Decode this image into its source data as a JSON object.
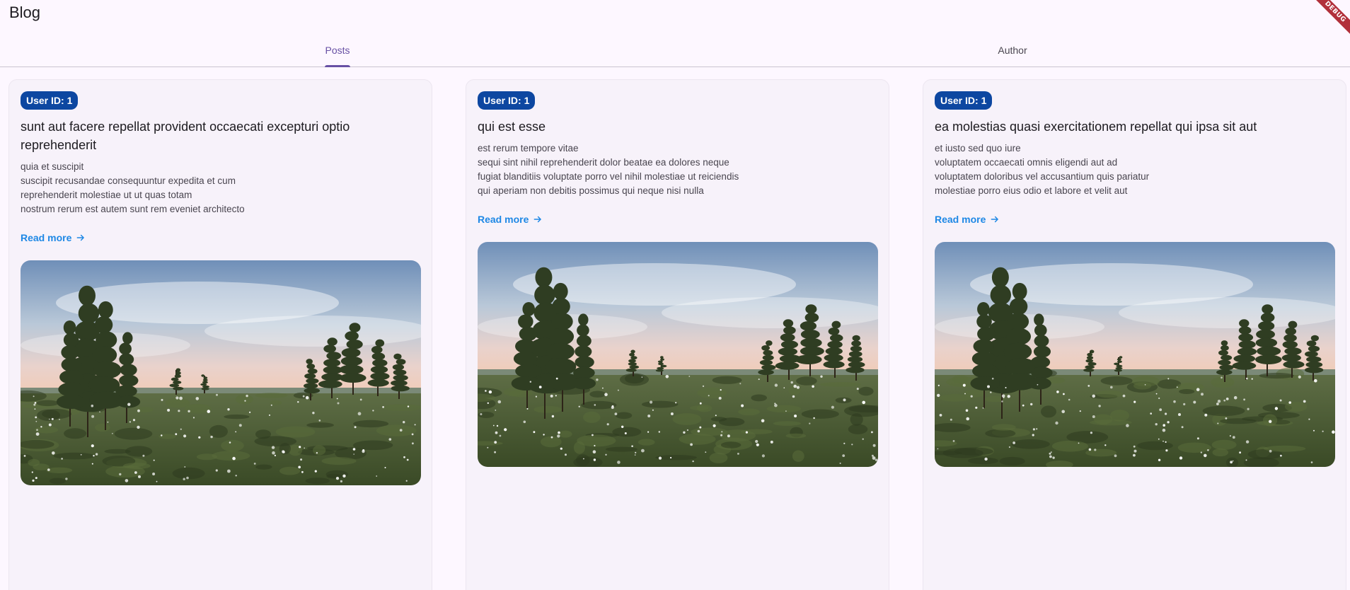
{
  "app": {
    "title": "Blog",
    "debug_banner": "DEBUG"
  },
  "tabs": [
    {
      "label": "Posts",
      "active": true
    },
    {
      "label": "Author",
      "active": false
    }
  ],
  "posts": [
    {
      "badge": "User ID: 1",
      "title": "sunt aut facere repellat provident occaecati excepturi optio reprehenderit",
      "body": "quia et suscipit\nsuscipit recusandae consequuntur expedita et cum\nreprehenderit molestiae ut ut quas totam\nnostrum rerum est autem sunt rem eveniet architecto",
      "read_more": "Read more",
      "image_icon": "landscape-photo"
    },
    {
      "badge": "User ID: 1",
      "title": "qui est esse",
      "body": "est rerum tempore vitae\nsequi sint nihil reprehenderit dolor beatae ea dolores neque\nfugiat blanditiis voluptate porro vel nihil molestiae ut reiciendis\nqui aperiam non debitis possimus qui neque nisi nulla",
      "read_more": "Read more",
      "image_icon": "landscape-photo"
    },
    {
      "badge": "User ID: 1",
      "title": "ea molestias quasi exercitationem repellat qui ipsa sit aut",
      "body": "et iusto sed quo iure\nvoluptatem occaecati omnis eligendi aut ad\nvoluptatem doloribus vel accusantium quis pariatur\nmolestiae porro eius odio et labore et velit aut",
      "read_more": "Read more",
      "image_icon": "landscape-photo"
    }
  ],
  "colors": {
    "background": "#fdf7ff",
    "card": "#f7f2fa",
    "badge": "#0d47a1",
    "link": "#1e88e5",
    "tab_active": "#6750a4"
  }
}
